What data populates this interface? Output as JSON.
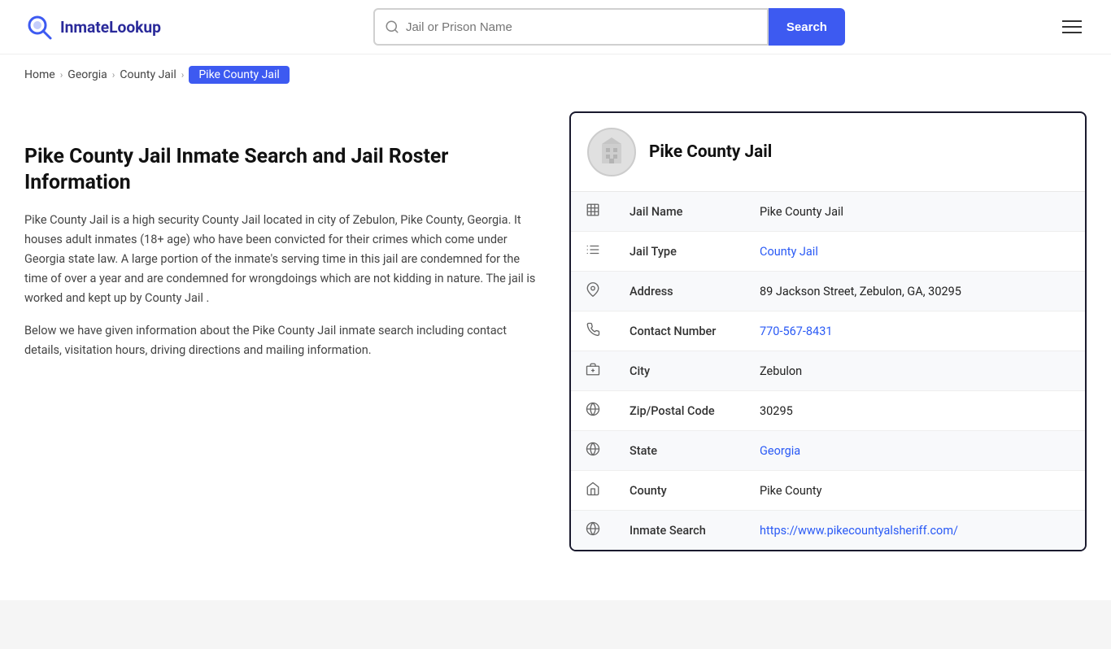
{
  "header": {
    "logo_text": "InmateLookup",
    "search_placeholder": "Jail or Prison Name",
    "search_button_label": "Search"
  },
  "breadcrumb": {
    "home": "Home",
    "state": "Georgia",
    "type": "County Jail",
    "current": "Pike County Jail"
  },
  "main": {
    "page_title": "Pike County Jail Inmate Search and Jail Roster Information",
    "description1": "Pike County Jail is a high security County Jail located in city of Zebulon, Pike County, Georgia. It houses adult inmates (18+ age) who have been convicted for their crimes which come under Georgia state law. A large portion of the inmate's serving time in this jail are condemned for the time of over a year and are condemned for wrongdoings which are not kidding in nature. The jail is worked and kept up by County Jail .",
    "description2": "Below we have given information about the Pike County Jail inmate search including contact details, visitation hours, driving directions and mailing information."
  },
  "info_card": {
    "title": "Pike County Jail",
    "rows": [
      {
        "icon": "jail",
        "label": "Jail Name",
        "value": "Pike County Jail",
        "link": null
      },
      {
        "icon": "type",
        "label": "Jail Type",
        "value": "County Jail",
        "link": "#"
      },
      {
        "icon": "address",
        "label": "Address",
        "value": "89 Jackson Street, Zebulon, GA, 30295",
        "link": null
      },
      {
        "icon": "phone",
        "label": "Contact Number",
        "value": "770-567-8431",
        "link": "tel:7705678431"
      },
      {
        "icon": "city",
        "label": "City",
        "value": "Zebulon",
        "link": null
      },
      {
        "icon": "zip",
        "label": "Zip/Postal Code",
        "value": "30295",
        "link": null
      },
      {
        "icon": "state",
        "label": "State",
        "value": "Georgia",
        "link": "#"
      },
      {
        "icon": "county",
        "label": "County",
        "value": "Pike County",
        "link": null
      },
      {
        "icon": "web",
        "label": "Inmate Search",
        "value": "https://www.pikecountyalsheriff.com/",
        "link": "https://www.pikecountyalsheriff.com/"
      }
    ]
  }
}
